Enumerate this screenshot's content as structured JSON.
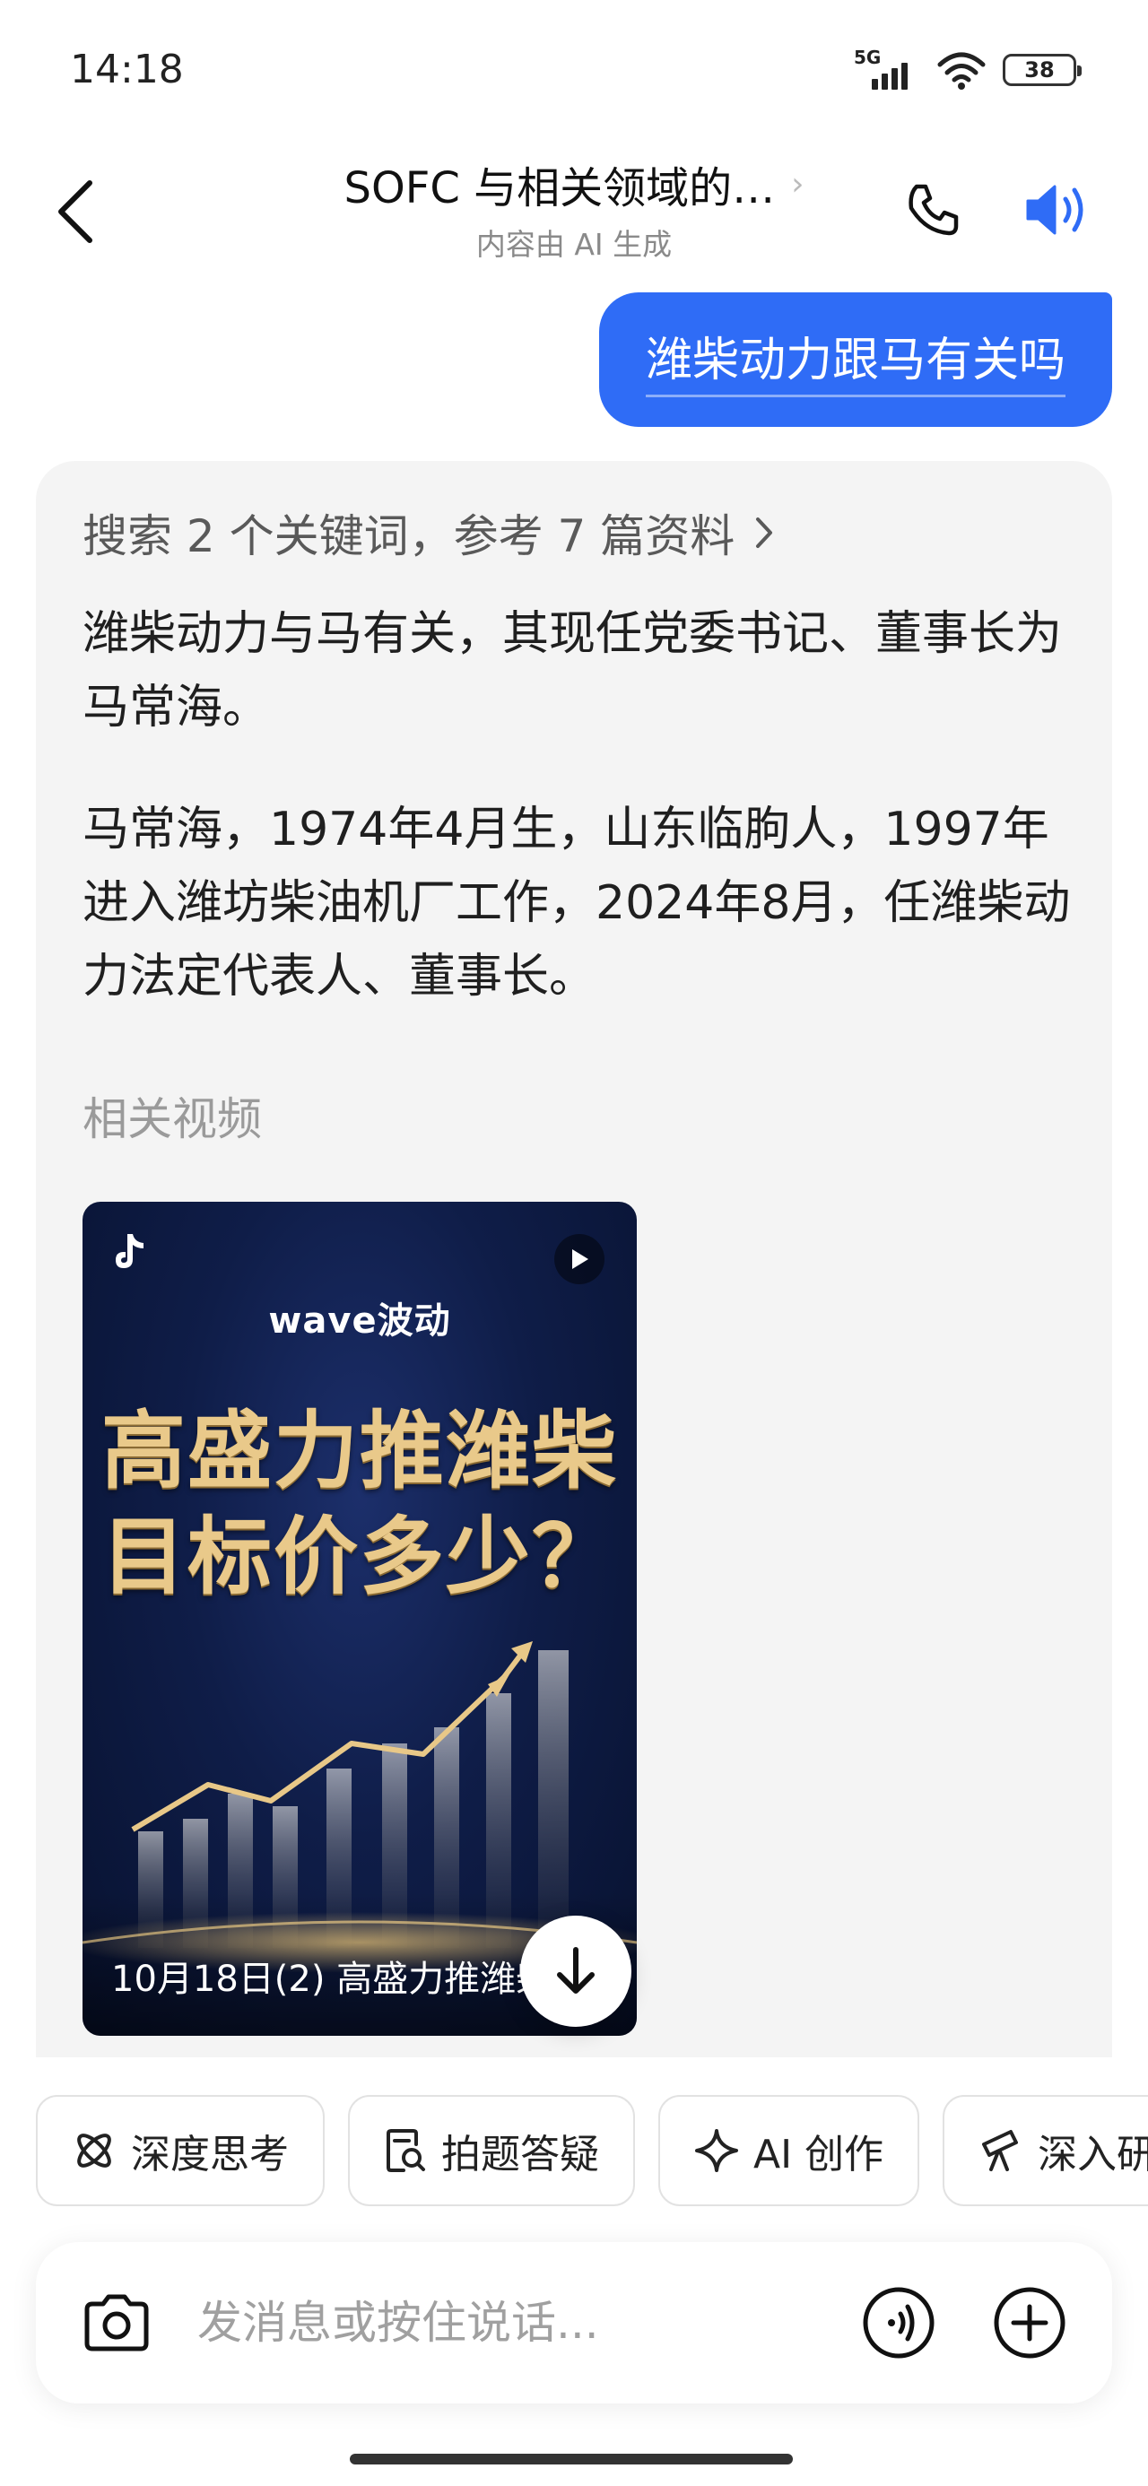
{
  "status_bar": {
    "time": "14:18",
    "network": "5G",
    "battery": "38"
  },
  "header": {
    "title": "SOFC 与相关领域的…",
    "subtitle": "内容由 AI 生成"
  },
  "conversation": {
    "user_message": "潍柴动力跟马有关吗",
    "ai_response": {
      "search_summary": "搜索 2 个关键词，参考 7 篇资料",
      "paragraphs": [
        "潍柴动力与马有关，其现任党委书记、董事长为马常海。",
        "马常海，1974年4月生，山东临朐人，1997年进入潍坊柴油机厂工作，2024年8月，任潍柴动力法定代表人、董事长。"
      ],
      "related_videos_label": "相关视频",
      "video": {
        "brand": "wave波动",
        "headline_line1": "高盛力推潍柴",
        "headline_line2": "目标价多少？",
        "caption": "10月18日(2) 高盛力推潍柴"
      }
    }
  },
  "chips": [
    {
      "label": "深度思考",
      "icon": "atom-icon"
    },
    {
      "label": "拍题答疑",
      "icon": "photo-search-icon"
    },
    {
      "label": "AI 创作",
      "icon": "sparkle-icon"
    },
    {
      "label": "深入研究",
      "icon": "telescope-icon"
    }
  ],
  "input": {
    "placeholder": "发消息或按住说话..."
  },
  "colors": {
    "accent": "#2f6cf6",
    "card_bg": "#f4f4f4",
    "video_gold": "#e9c98a"
  }
}
